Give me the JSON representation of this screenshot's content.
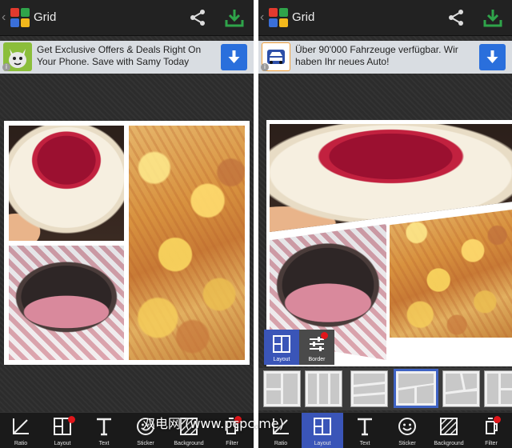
{
  "screens": [
    {
      "app": {
        "title": "Grid",
        "back_glyph": "‹"
      },
      "toolbar": {
        "share_icon": "share-icon",
        "download_icon": "download-icon",
        "download_color": "#2fa44a"
      },
      "ad": {
        "text": "Get Exclusive Offers & Deals Right On Your Phone. Save with Samy Today",
        "info_glyph": "i",
        "icon": "samy-app-icon"
      },
      "tools": [
        {
          "label": "Ratio",
          "icon": "ratio-icon",
          "badge": false,
          "active": false
        },
        {
          "label": "Layout",
          "icon": "layout-icon",
          "badge": true,
          "active": false
        },
        {
          "label": "Text",
          "icon": "text-icon",
          "badge": false,
          "active": false
        },
        {
          "label": "Sticker",
          "icon": "sticker-icon",
          "badge": false,
          "active": false
        },
        {
          "label": "Background",
          "icon": "background-icon",
          "badge": false,
          "active": false
        },
        {
          "label": "Filter",
          "icon": "filter-icon",
          "badge": true,
          "active": false
        }
      ]
    },
    {
      "app": {
        "title": "Grid",
        "back_glyph": "‹"
      },
      "toolbar": {
        "share_icon": "share-icon",
        "download_icon": "download-icon",
        "download_color": "#2fa44a"
      },
      "ad": {
        "text": "Über 90'000 Fahrzeuge verfügbar. Wir haben Ihr neues Auto!",
        "info_glyph": "i",
        "icon": "car-app-icon"
      },
      "popup": [
        {
          "label": "Layout",
          "icon": "layout-icon",
          "active": true
        },
        {
          "label": "Border",
          "icon": "border-sliders-icon",
          "active": false,
          "badge": true
        }
      ],
      "layout_thumbnails": {
        "count": 6,
        "selected_index": 3
      },
      "tools": [
        {
          "label": "Ratio",
          "icon": "ratio-icon",
          "badge": false,
          "active": false
        },
        {
          "label": "Layout",
          "icon": "layout-icon",
          "badge": false,
          "active": true
        },
        {
          "label": "Text",
          "icon": "text-icon",
          "badge": false,
          "active": false
        },
        {
          "label": "Sticker",
          "icon": "sticker-icon",
          "badge": false,
          "active": false
        },
        {
          "label": "Background",
          "icon": "background-icon",
          "badge": false,
          "active": false
        },
        {
          "label": "Filter",
          "icon": "filter-icon",
          "badge": true,
          "active": false
        }
      ]
    }
  ],
  "watermark": {
    "text": "双电网 (www.pcpc.me)"
  },
  "colors": {
    "accent": "#3a55b8",
    "badge": "#e0161b",
    "ad_button": "#2a6fdc",
    "download": "#2fa44a"
  }
}
